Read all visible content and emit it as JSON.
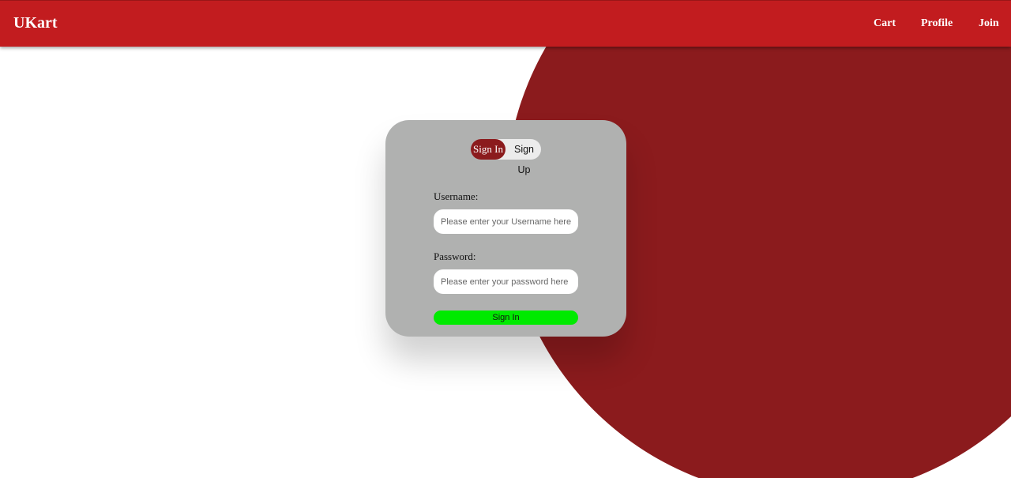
{
  "navbar": {
    "brand": "UKart",
    "links": {
      "cart": "Cart",
      "profile": "Profile",
      "join": "Join"
    }
  },
  "auth_card": {
    "toggle": {
      "sign_in": "Sign In",
      "sign_up": "Sign Up",
      "active": "sign_in"
    },
    "username": {
      "label": "Username:",
      "value": "",
      "placeholder": "Please enter your Username here"
    },
    "password": {
      "label": "Password:",
      "value": "",
      "placeholder": "Please enter your password here"
    },
    "submit_label": "Sign In"
  },
  "colors": {
    "navbar": "#c21c1f",
    "accent_dark_red": "#8b1b1d",
    "card": "#b0b1b0",
    "submit": "#00ea00"
  }
}
